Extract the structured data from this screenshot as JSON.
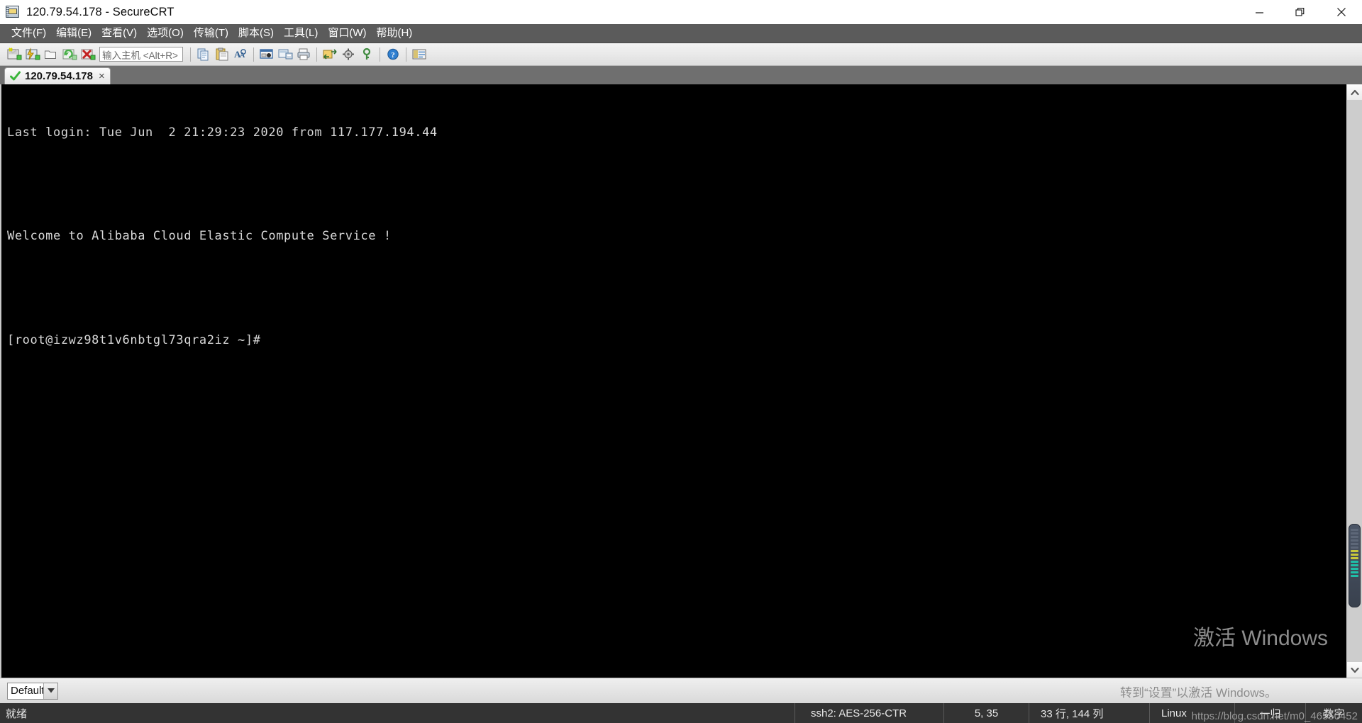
{
  "window": {
    "title": "120.79.54.178 - SecureCRT",
    "icon": "securecrt-app-icon",
    "minimize_label": "—",
    "maximize_label": "❐",
    "close_label": "✕"
  },
  "menubar": {
    "items": [
      {
        "label": "文件(F)",
        "name": "menu-file"
      },
      {
        "label": "编辑(E)",
        "name": "menu-edit"
      },
      {
        "label": "查看(V)",
        "name": "menu-view"
      },
      {
        "label": "选项(O)",
        "name": "menu-options"
      },
      {
        "label": "传输(T)",
        "name": "menu-transfer"
      },
      {
        "label": "脚本(S)",
        "name": "menu-script"
      },
      {
        "label": "工具(L)",
        "name": "menu-tools"
      },
      {
        "label": "窗口(W)",
        "name": "menu-window"
      },
      {
        "label": "帮助(H)",
        "name": "menu-help"
      }
    ]
  },
  "toolbar": {
    "host_input_placeholder": "输入主机 <Alt+R>",
    "host_input_value": "",
    "buttons": [
      {
        "name": "new-session-icon",
        "tooltip": "新建会话"
      },
      {
        "name": "quick-connect-icon",
        "tooltip": "快速连接"
      },
      {
        "name": "open-session-folder-icon",
        "tooltip": "打开"
      },
      {
        "name": "reconnect-icon",
        "tooltip": "重新连接"
      },
      {
        "name": "disconnect-icon",
        "tooltip": "断开连接"
      },
      {
        "name": "copy-icon",
        "tooltip": "复制"
      },
      {
        "name": "paste-icon",
        "tooltip": "粘贴"
      },
      {
        "name": "find-icon",
        "tooltip": "查找"
      },
      {
        "name": "log-session-icon",
        "tooltip": "记录会话"
      },
      {
        "name": "print-screen-icon",
        "tooltip": "打印屏幕"
      },
      {
        "name": "print-icon",
        "tooltip": "打印"
      },
      {
        "name": "file-transfer-icon",
        "tooltip": "传输"
      },
      {
        "name": "session-options-icon",
        "tooltip": "会话选项"
      },
      {
        "name": "key-icon",
        "tooltip": "密钥"
      },
      {
        "name": "help-icon",
        "tooltip": "帮助"
      },
      {
        "name": "session-manager-icon",
        "tooltip": "会话管理器"
      }
    ]
  },
  "tabs": [
    {
      "label": "120.79.54.178",
      "status_icon": "connected-check-icon",
      "close_label": "×",
      "active": true
    }
  ],
  "terminal": {
    "lines": [
      "Last login: Tue Jun  2 21:29:23 2020 from 117.177.194.44",
      "",
      "Welcome to Alibaba Cloud Elastic Compute Service !",
      "",
      "[root@izwz98t1v6nbtgl73qra2iz ~]#"
    ],
    "background": "#000000",
    "foreground": "#d8d8d8"
  },
  "scrollbar": {
    "up_arrow": "∧",
    "down_arrow": "∨"
  },
  "session_bar": {
    "profile_value": "Default",
    "dropdown_arrow": "▼"
  },
  "statusbar": {
    "ready": "就绪",
    "encryption": "ssh2: AES-256-CTR",
    "cursor_position": "5, 35",
    "screen_size": "33 行, 144 列",
    "emulation": "Linux",
    "ime_mode": "一归",
    "ime_digit": "数字"
  },
  "watermark": {
    "activate_title": "激活 Windows",
    "activate_sub": "转到“设置”以激活 Windows。",
    "source_url": "https://blog.csdn.net/m0_46550452"
  }
}
